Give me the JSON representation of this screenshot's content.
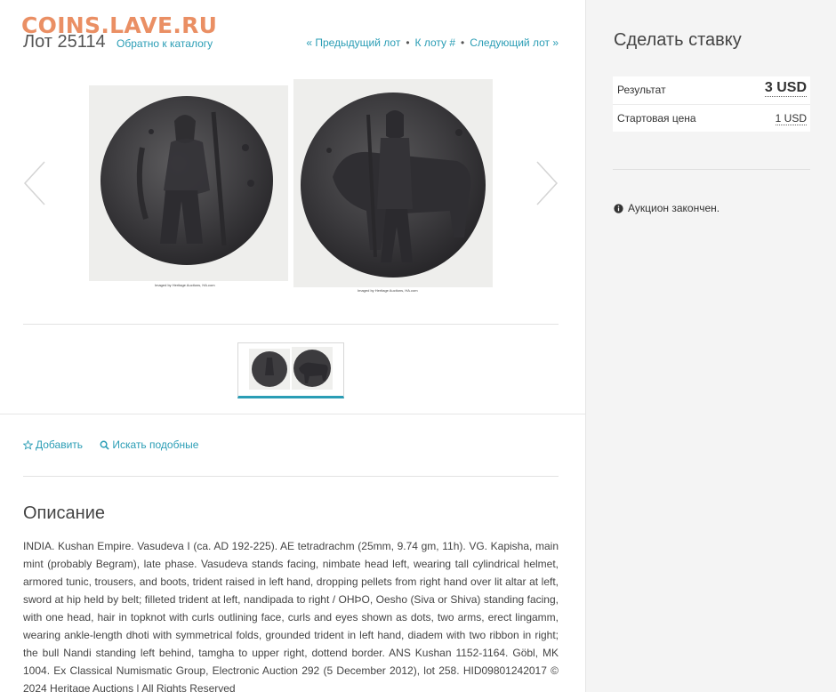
{
  "watermark": "COINS.LAVE.RU",
  "lot": {
    "title": "Лот 25114",
    "back_link": "Обратно к каталогу",
    "nav": {
      "prev": "« Предыдущий лот",
      "goto": "К лоту #",
      "next": "Следующий лот »"
    }
  },
  "gallery": {
    "captions": [
      "Imaged by Heritage Auctions, HA.com",
      "Imaged by Heritage Auctions, HA.com"
    ],
    "prev_icon": "chevron-left-icon",
    "next_icon": "chevron-right-icon"
  },
  "actions": {
    "add": "Добавить",
    "search": "Искать подобные"
  },
  "description": {
    "title": "Описание",
    "text": "INDIA. Kushan Empire. Vasudeva I (ca. AD 192-225). AE tetradrachm (25mm, 9.74 gm, 11h). VG. Kapisha, main mint (probably Begram), late phase. Vasudeva stands facing, nimbate head left, wearing tall cylindrical helmet, armored tunic, trousers, and boots, trident raised in left hand, dropping pellets from right hand over lit altar at left, sword at hip held by belt; filleted trident at left, nandipada to right / OHÞO, Oesho (Siva or Shiva) standing facing, with one head, hair in topknot with curls outlining face, curls and eyes shown as dots, two arms, erect lingamm, wearing ankle-length dhoti with symmetrical folds, grounded trident in left hand, diadem with two ribbon in right; the bull Nandi standing left behind, tamgha to upper right, dottend border. ANS Kushan 1152-1164. Göbl, MK 1004. Ex Classical Numismatic Group, Electronic Auction 292 (5 December 2012), lot 258. HID09801242017 © 2024 Heritage Auctions | All Rights Reserved"
  },
  "bid": {
    "title": "Сделать ставку",
    "result_label": "Результат",
    "result_value": "3 USD",
    "start_label": "Стартовая цена",
    "start_value": "1 USD",
    "status": "Аукцион закончен."
  },
  "colors": {
    "accent": "#2a9db5",
    "watermark": "#e98a5c",
    "sidebar_bg": "#f4f4f4"
  }
}
